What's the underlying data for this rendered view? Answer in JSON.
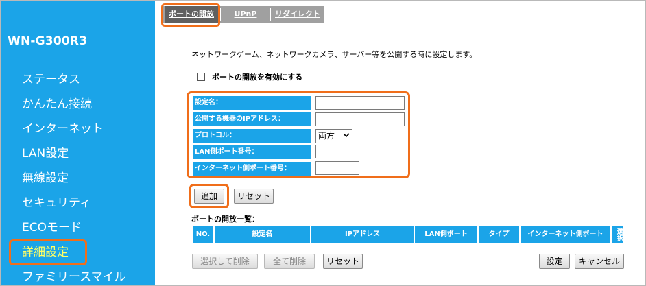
{
  "sidebar": {
    "model": "WN-G300R3",
    "items": [
      {
        "label": "ステータス"
      },
      {
        "label": "かんたん接続"
      },
      {
        "label": "インターネット"
      },
      {
        "label": "LAN設定"
      },
      {
        "label": "無線設定"
      },
      {
        "label": "セキュリティ"
      },
      {
        "label": "ECOモード"
      },
      {
        "label": "詳細設定",
        "active": true
      },
      {
        "label": "ファミリースマイル"
      }
    ]
  },
  "tabs": [
    {
      "label": "ポートの開放",
      "active": true
    },
    {
      "label": "UPnP"
    },
    {
      "label": "リダイレクト"
    }
  ],
  "description": "ネットワークゲーム、ネットワークカメラ、サーバー等を公開する時に設定します。",
  "enable": {
    "label": "ポートの開放を有効にする",
    "checked": false
  },
  "form": {
    "setting_name_label": "設定名：",
    "ip_label": "公開する機器のIPアドレス：",
    "protocol_label": "プロトコル：",
    "protocol_value": "両方",
    "lan_port_label": "LAN側ポート番号：",
    "internet_port_label": "インターネット側ポート番号：",
    "setting_name_value": "",
    "ip_value": "",
    "lan_port_value": "",
    "internet_port_value": ""
  },
  "buttons": {
    "add": "追加",
    "reset": "リセット",
    "delete_selected": "選択して削除",
    "delete_all": "全て削除",
    "reset_list": "リセット",
    "apply": "設定",
    "cancel": "キャンセル"
  },
  "list": {
    "title": "ポートの開放一覧：",
    "columns": [
      "NO.",
      "設定名",
      "IPアドレス",
      "LAN側ポート",
      "タイプ",
      "インターネット側ポート",
      "選択"
    ]
  },
  "colors": {
    "sidebar_bg": "#1ba4e8",
    "highlight": "#f06e1a",
    "active_nav": "#ffff66"
  }
}
